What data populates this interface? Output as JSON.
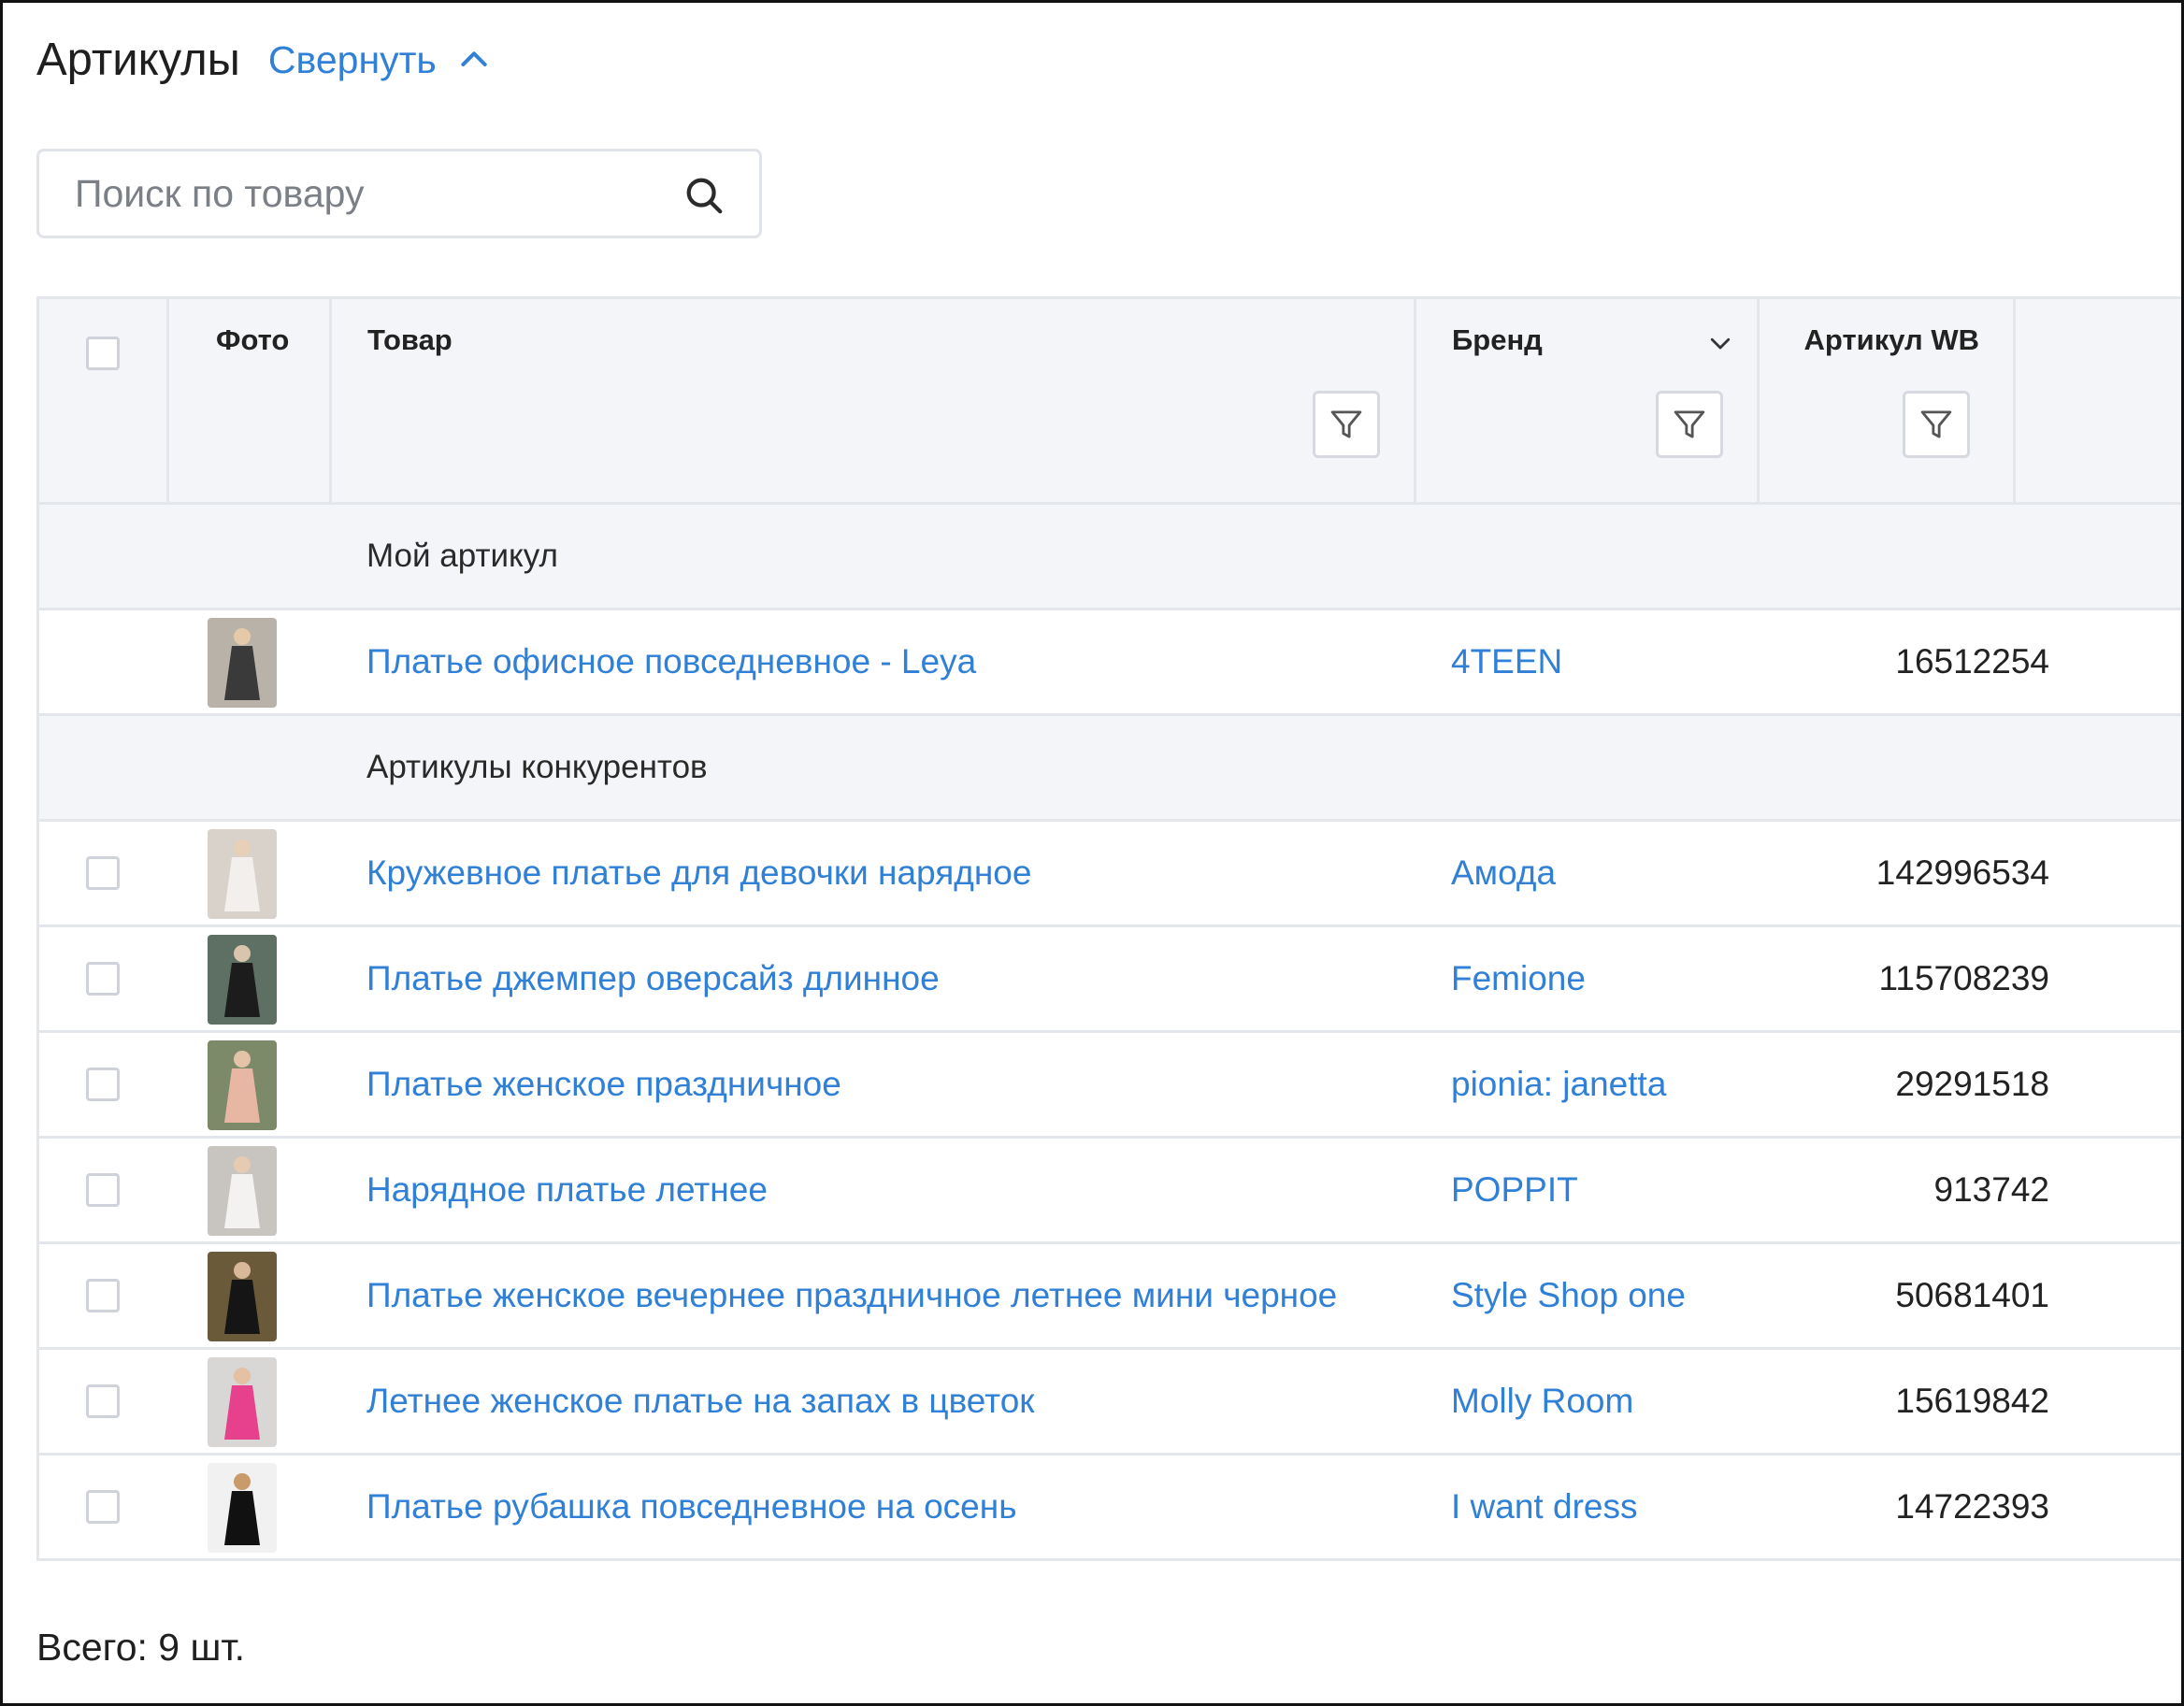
{
  "header": {
    "title": "Артикулы",
    "collapse_label": "Свернуть",
    "collapse_icon": "chevron-up-icon"
  },
  "search": {
    "placeholder": "Поиск по товару",
    "value": "",
    "icon": "search-icon"
  },
  "table": {
    "columns": {
      "photo": "Фото",
      "product": "Товар",
      "brand": "Бренд",
      "article": "Артикул WB"
    },
    "groups": [
      {
        "label": "Мой артикул",
        "rows": [
          {
            "product": "Платье офисное повседневное - Leya",
            "brand": "4TEEN",
            "article": "16512254",
            "has_checkbox": false,
            "thumb": [
              "#b9b2a8",
              "#3a3a3a",
              "#e6c9a8"
            ]
          }
        ]
      },
      {
        "label": "Артикулы конкурентов",
        "rows": [
          {
            "product": "Кружевное платье для девочки нарядное",
            "brand": "Амода",
            "article": "142996534",
            "has_checkbox": true,
            "thumb": [
              "#d8d2cb",
              "#f2efec",
              "#e8cfb8"
            ]
          },
          {
            "product": "Платье джемпер оверсайз длинное",
            "brand": "Femione",
            "article": "115708239",
            "has_checkbox": true,
            "thumb": [
              "#5e6f64",
              "#1c1c1c",
              "#d9c4ad"
            ]
          },
          {
            "product": "Платье женское праздничное",
            "brand": "pionia: janetta",
            "article": "29291518",
            "has_checkbox": true,
            "thumb": [
              "#7d8a6a",
              "#e8b7a4",
              "#e4c3a8"
            ]
          },
          {
            "product": "Нарядное платье летнее",
            "brand": "POPPIT",
            "article": "913742",
            "has_checkbox": true,
            "thumb": [
              "#c8c4c0",
              "#f4f2f0",
              "#e6cbb2"
            ]
          },
          {
            "product": "Платье женское вечернее праздничное летнее мини черное",
            "brand": "Style Shop one",
            "article": "50681401",
            "has_checkbox": true,
            "thumb": [
              "#6b5a3a",
              "#151515",
              "#d8b899"
            ]
          },
          {
            "product": "Летнее женское платье на запах в цветок",
            "brand": "Molly Room",
            "article": "15619842",
            "has_checkbox": true,
            "thumb": [
              "#d9d7d6",
              "#e7408c",
              "#e4c0a4"
            ]
          },
          {
            "product": "Платье рубашка повседневное на осень",
            "brand": "I want dress",
            "article": "14722393",
            "has_checkbox": true,
            "thumb": [
              "#f1f1f1",
              "#111111",
              "#c99a6a"
            ]
          }
        ]
      }
    ]
  },
  "footer": {
    "total": "Всего: 9 шт."
  },
  "colors": {
    "link": "#2f80d6",
    "header_bg": "#f3f5f8",
    "border": "#e3e6ea"
  }
}
